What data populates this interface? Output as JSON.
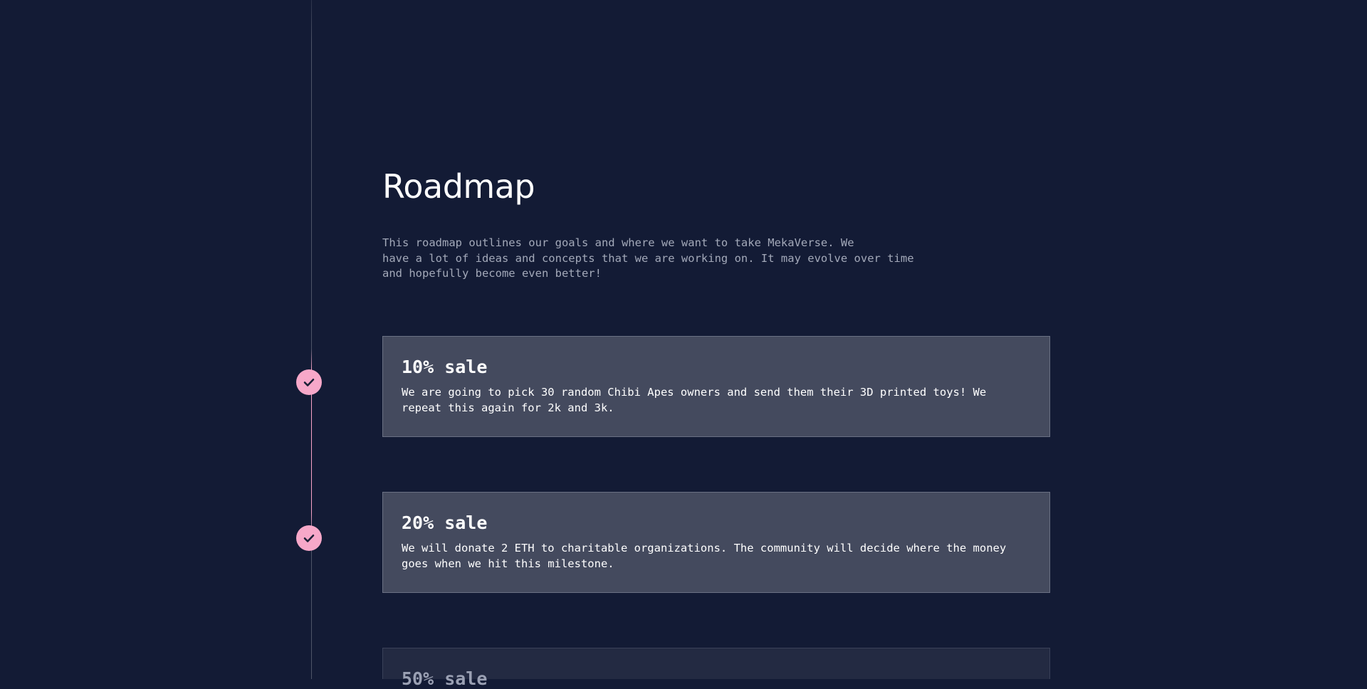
{
  "roadmap": {
    "title": "Roadmap",
    "intro": "This roadmap outlines our goals and where we want to take MekaVerse. We\nhave a lot of ideas and concepts that we are working on. It may evolve over time\nand hopefully become even better!",
    "milestones": [
      {
        "title": "10% sale",
        "description": "We are going to pick 30 random Chibi Apes owners and send them their 3D printed toys! We repeat this again for 2k and 3k.",
        "completed": true,
        "icon": "check-icon"
      },
      {
        "title": "20% sale",
        "description": "We will donate 2 ETH to charitable organizations. The community will decide where the money goes when we hit this milestone.",
        "completed": true,
        "icon": "check-icon"
      },
      {
        "title": "50% sale",
        "description": "",
        "completed": false
      }
    ]
  },
  "colors": {
    "background": "#131b35",
    "card_active": "#444a5e",
    "card_inactive": "#232a42",
    "accent_pink": "#f7a8c9",
    "muted_text": "#a3a9b9"
  }
}
